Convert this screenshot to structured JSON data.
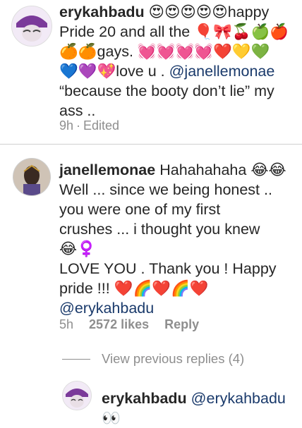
{
  "comments": [
    {
      "username": "erykahbadu",
      "text": " 😍😍😍😍😍happy\nPride 20 and all the 🎈🎀🍒🍏🍎\n🍊🍊gays. 💓💓💓💓❤️💛💚\n💙💜💖love u . ",
      "mention": "@janellemonae",
      "text2": "\n“because the booty don’t lie” my\nass ..",
      "time": "9h",
      "status": "Edited"
    },
    {
      "username": "janellemonae",
      "text": " Hahahahaha 😂😂\nWell ... since we being honest ..\nyou were one of my first\ncrushes ... i thought you knew\n😂♀️\nLOVE YOU . Thank you ! Happy\npride !!! ❤️🌈❤️🌈❤️\n",
      "mention": "@erykahbadu",
      "time": "5h",
      "likes": "2572 likes",
      "reply": "Reply"
    },
    {
      "username": "erykahbadu",
      "text": " ",
      "mention": "@erykahbadu",
      "text2": "\n👀"
    }
  ],
  "view_previous": "View previous replies (4)",
  "colors": {
    "mention": "#1a3a6b",
    "meta": "#8e8e8e",
    "divider": "#cfcfcf"
  }
}
